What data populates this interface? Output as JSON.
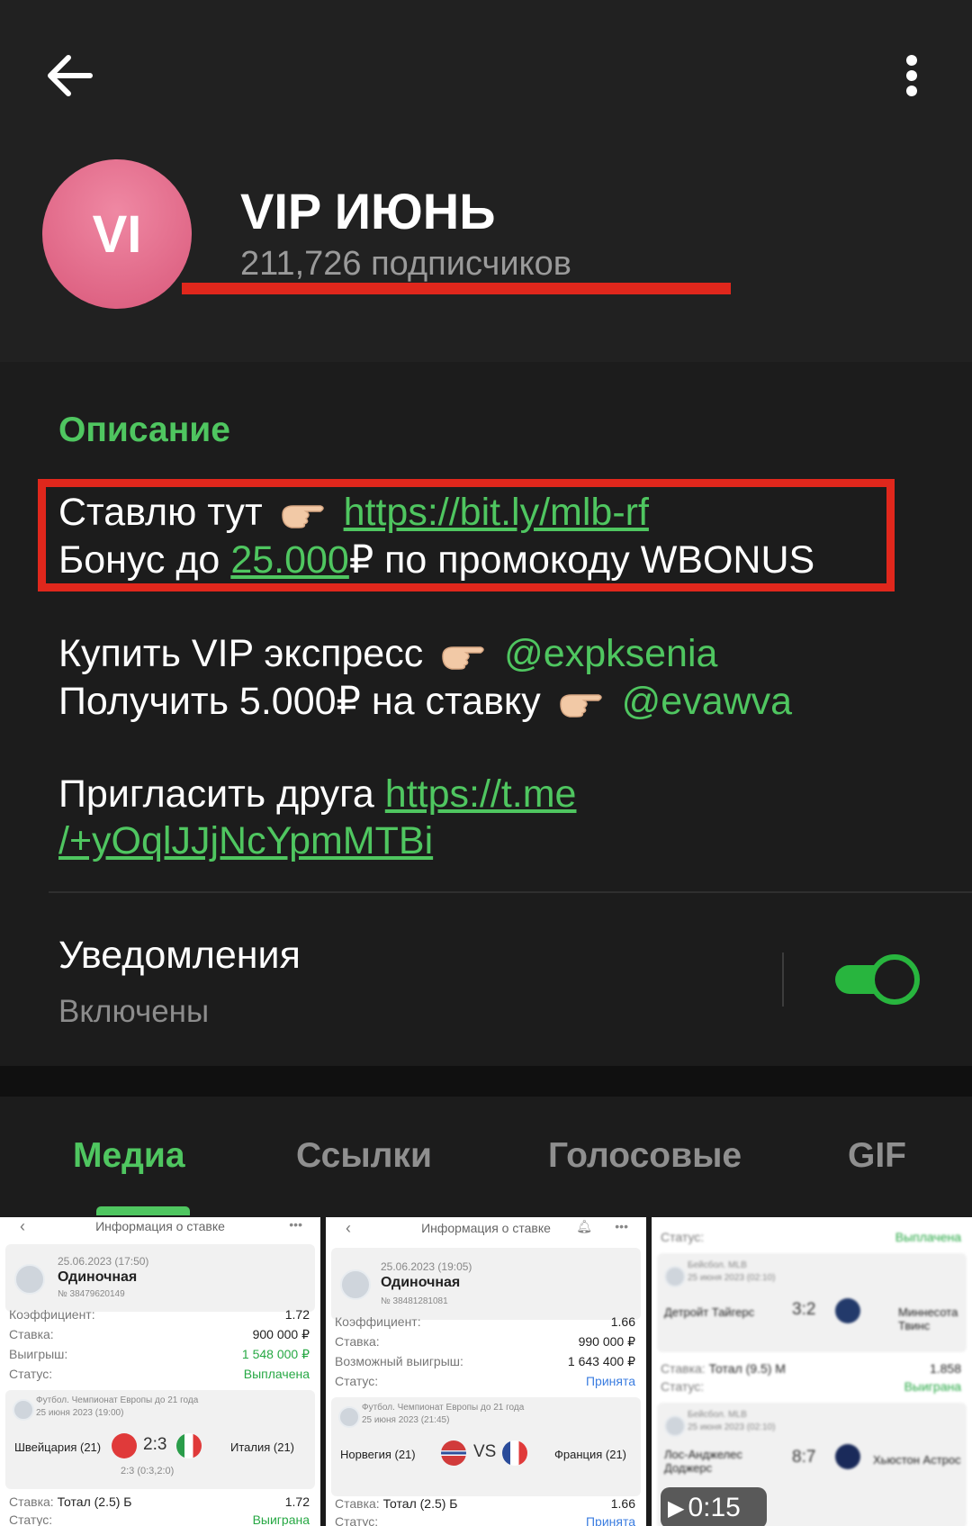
{
  "header": {
    "avatar_initials": "VI",
    "channel_title": "VIP ИЮНЬ",
    "subscribers": "211,726 подписчиков"
  },
  "description": {
    "label": "Описание",
    "line1_text": "Ставлю тут",
    "line1_link": "https://bit.ly/mlb-rf",
    "line2_prefix": "Бонус до",
    "line2_link": "25.000",
    "line2_suffix": "₽ по промокоду WBONUS",
    "line3_text": "Купить VIP экспресс",
    "line3_mention": "@expksenia",
    "line4_text": "Получить 5.000₽ на ставку",
    "line4_mention": "@evawva",
    "line5_text": "Пригласить друга",
    "line5_link_part1": "https://t.me",
    "line5_link_part2": "/+yOqlJJjNcYpmMTBi"
  },
  "notifications": {
    "label": "Уведомления",
    "status": "Включены",
    "enabled": true
  },
  "tabs": [
    {
      "label": "Медиа",
      "active": true
    },
    {
      "label": "Ссылки",
      "active": false
    },
    {
      "label": "Голосовые",
      "active": false
    },
    {
      "label": "GIF",
      "active": false
    }
  ],
  "media": [
    {
      "header": "Информация о ставке",
      "date": "25.06.2023 (17:50)",
      "kind": "Одиночная",
      "number": "№ 38479620149",
      "rows": [
        {
          "k": "Коэффициент:",
          "v": "1.72"
        },
        {
          "k": "Ставка:",
          "v": "900 000 ₽"
        },
        {
          "k": "Выигрыш:",
          "v": "1 548 000 ₽"
        },
        {
          "k": "Статус:",
          "v": "Выплачена"
        }
      ],
      "league": "Футбол. Чемпионат Европы до 21 года",
      "match_date": "25 июня 2023 (19:00)",
      "team1": "Швейцария (21)",
      "score": "2:3",
      "team2": "Италия (21)",
      "score_detail": "2:3 (0:3,2:0)",
      "bet_label": "Ставка:",
      "bet": "Тотал (2.5) Б",
      "bet_coef": "1.72",
      "status_label": "Статус:",
      "status": "Выиграна"
    },
    {
      "header": "Информация о ставке",
      "date": "25.06.2023 (19:05)",
      "kind": "Одиночная",
      "number": "№ 38481281081",
      "rows": [
        {
          "k": "Коэффициент:",
          "v": "1.66"
        },
        {
          "k": "Ставка:",
          "v": "990 000 ₽"
        },
        {
          "k": "Возможный выигрыш:",
          "v": "1 643 400 ₽"
        },
        {
          "k": "Статус:",
          "v": "Принята"
        }
      ],
      "league": "Футбол. Чемпионат Европы до 21 года",
      "match_date": "25 июня 2023 (21:45)",
      "team1": "Норвегия (21)",
      "score": "VS",
      "team2": "Франция (21)",
      "bet_label": "Ставка:",
      "bet": "Тотал (2.5) Б",
      "bet_coef": "1.66",
      "status_label": "Статус:",
      "status": "Принята"
    },
    {
      "top_status_label": "Статус:",
      "top_status": "Выплачена",
      "league1": "Бейсбол. MLB",
      "match1_date": "25 июня 2023 (02:10)",
      "team1a": "Детройт Тайгерс",
      "score1": "3:2",
      "team1b": "Миннесота Твинс",
      "bet1_label": "Ставка:",
      "bet1": "Тотал (9.5) М",
      "bet1_coef": "1.858",
      "status1_label": "Статус:",
      "status1": "Выиграна",
      "league2": "Бейсбол. MLB",
      "match2_date": "25 июня 2023 (02:10)",
      "team2a": "Лос-Анджелес Доджерс",
      "score2": "8:7",
      "team2b": "Хьюстон Астрос",
      "duration": "0:15"
    }
  ],
  "colors": {
    "accent": "#4fc660",
    "highlight_red": "#e0271c",
    "avatar": "#e06d8e",
    "background": "#1c1c1c"
  }
}
